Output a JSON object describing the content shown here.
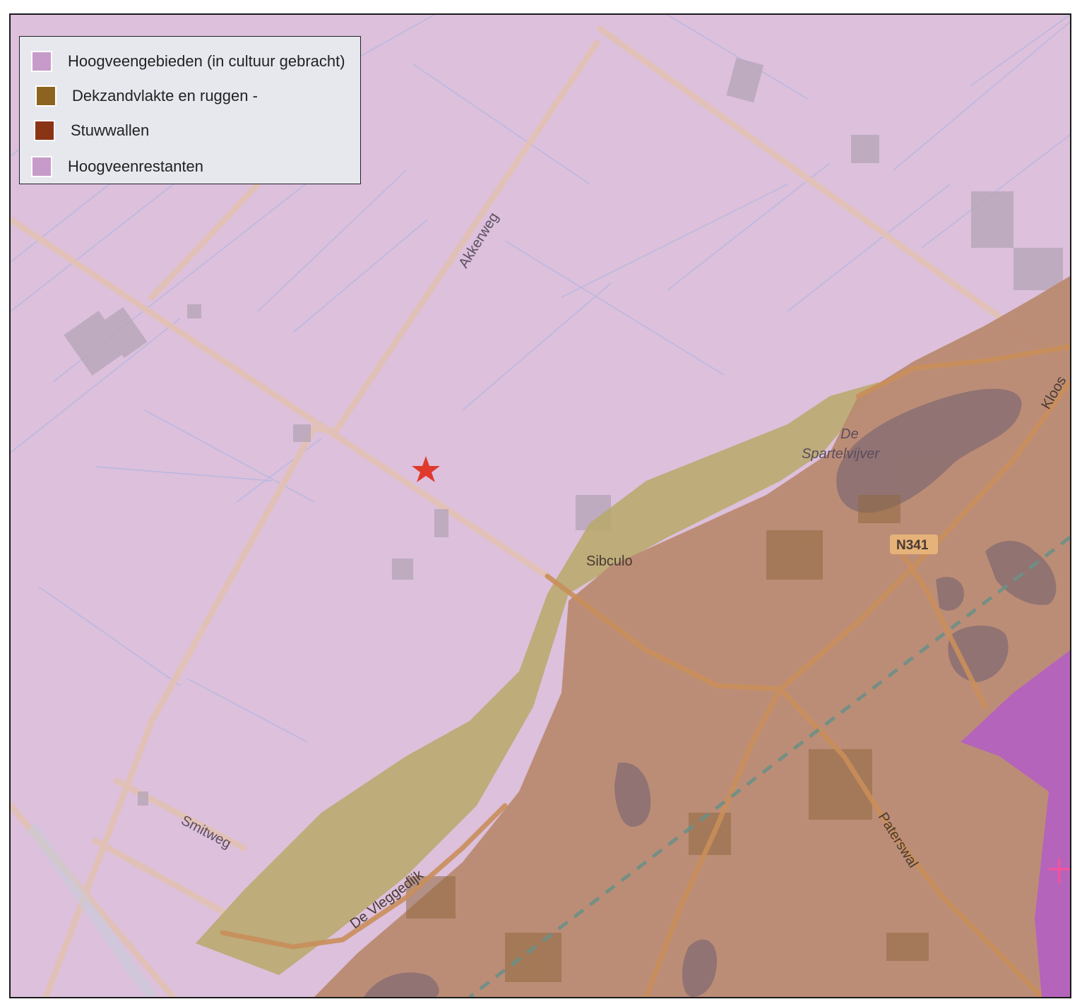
{
  "legend": {
    "items": [
      {
        "label": "Hoogveengebieden (in cultuur gebracht)",
        "color": "#c79bc9"
      },
      {
        "label": "Dekzandvlakte en ruggen -",
        "color": "#8c6420"
      },
      {
        "label": "Stuwwallen",
        "color": "#8a3416"
      },
      {
        "label": "Hoogveenrestanten",
        "color": "#c79bc9"
      }
    ]
  },
  "map": {
    "place_labels": {
      "akkerweg": "Akkerweg",
      "sibculo": "Sibculo",
      "de_spartelvijver_1": "De",
      "de_spartelvijver_2": "Spartelvijver",
      "kloosterweg": "Kloos",
      "n341": "N341",
      "smitweg": "Smitweg",
      "de_vleggedijk": "De Vleggedijk",
      "paterswal": "Paterswal"
    },
    "marker": {
      "icon": "red-star-icon",
      "color": "#e03a2c"
    },
    "colors": {
      "hoogveen": "#dcc0dc",
      "dekzand": "#b8a868",
      "stuwwal": "#b98a70",
      "hoogveenrestant": "#b462c0",
      "road": "#e2c2b4",
      "water": "#8a6e72"
    }
  }
}
